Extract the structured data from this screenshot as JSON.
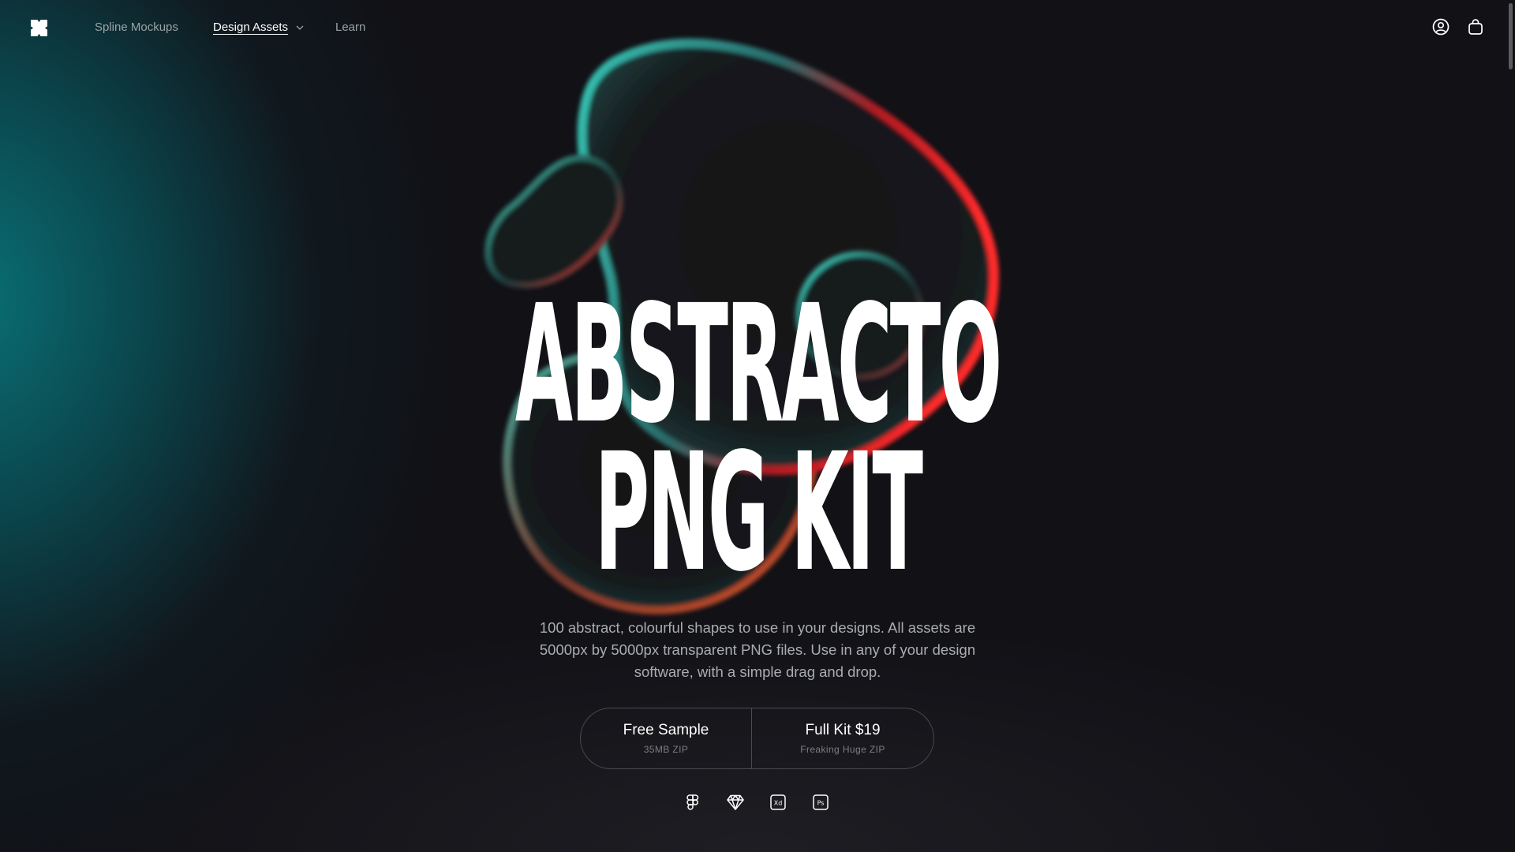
{
  "nav": {
    "logo_icon": "logo-mark-icon",
    "links": [
      {
        "label": "Spline Mockups"
      },
      {
        "label": "Design Assets"
      },
      {
        "label": "Learn"
      }
    ],
    "account_icon": "user-circle-icon",
    "cart_icon": "shopping-bag-icon"
  },
  "hero": {
    "title_line1": "ABSTRACTO",
    "title_line2": "PNG KIT",
    "description": "100 abstract, colourful shapes to use in your designs. All assets are 5000px by 5000px transparent PNG files. Use in any of your design software, with a simple drag and drop."
  },
  "cta": {
    "free": {
      "label": "Free Sample",
      "sub": "35MB ZIP"
    },
    "full": {
      "label": "Full Kit $19",
      "sub": "Freaking Huge ZIP"
    }
  },
  "apps": [
    "figma-icon",
    "sketch-icon",
    "adobe-xd-icon",
    "photoshop-icon"
  ],
  "colors": {
    "background": "#111116",
    "accent_teal": "#087679",
    "accent_red": "#e0212b",
    "text_primary": "#ffffff",
    "text_secondary": "#a9adb0"
  }
}
